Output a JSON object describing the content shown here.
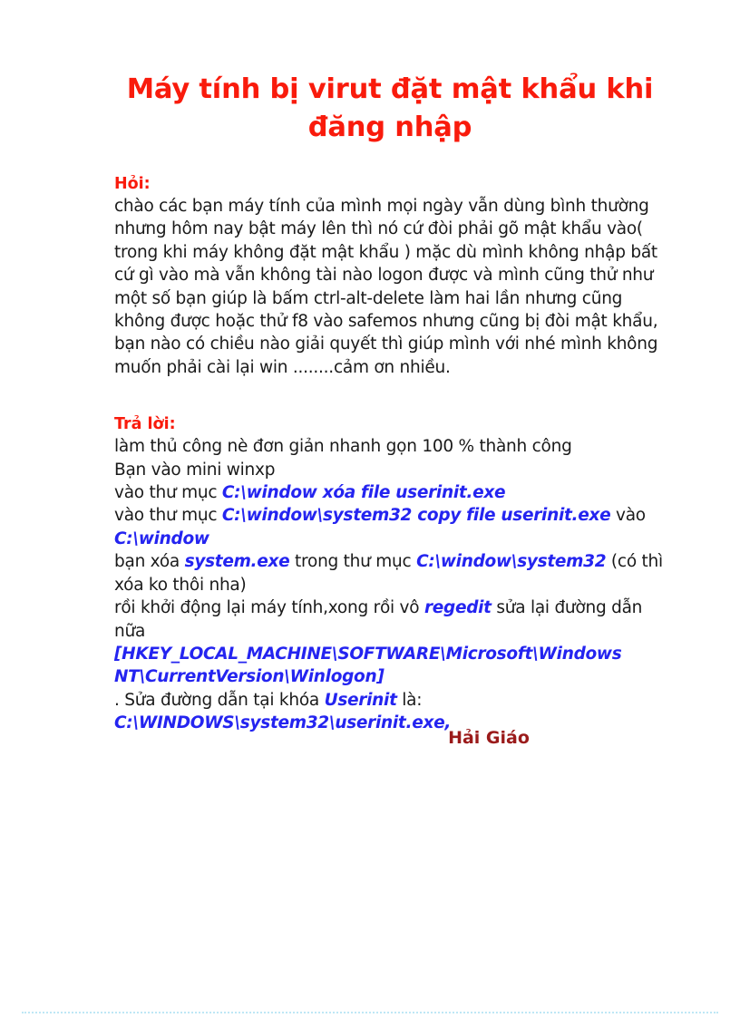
{
  "document": {
    "title": "Máy tính bị virut đặt mật khẩu khi đăng nhập",
    "title_color": "#F91B0C",
    "body_color": "#1a1a1a",
    "path_color": "#2424F0",
    "signature_color": "#9B1B1B",
    "rule_color": "#BEE7F5",
    "background": "#ffffff"
  },
  "question": {
    "label": "Hỏi:",
    "body": "chào các bạn máy tính của mình mọi ngày vẫn dùng bình thường nhưng hôm nay bật máy lên thì nó cứ đòi phải gõ mật khẩu vào( trong khi máy không đặt mật khẩu ) mặc dù mình không nhập bất cứ gì vào mà vẫn không tài nào logon được và mình cũng thử như một số bạn giúp là bấm ctrl-alt-delete làm hai lần nhưng cũng không được hoặc thử f8 vào safemos nhưng cũng bị đòi mật khẩu, bạn nào có chiều nào giải quyết thì giúp mình với nhé mình không muốn phải cài lại win ........cảm ơn nhiều."
  },
  "answer": {
    "label": "Trả lời:",
    "line1": "làm thủ công nè đơn giản nhanh gọn 100 % thành công",
    "line2": "Bạn vào mini winxp",
    "line3_pre": "vào thư mục ",
    "line3_path": "C:\\window xóa file userinit.exe",
    "line4_pre": "vào thư mục ",
    "line4_path": "C:\\window\\system32 copy file userinit.exe",
    "line4_mid": " vào",
    "line5_path": "C:\\window",
    "line6_pre": "bạn xóa ",
    "line6_path1": "system.exe",
    "line6_mid": " trong thư mục ",
    "line6_path2": "C:\\window\\system32",
    "line6_post": " (có thì xóa ko thôi nha)",
    "line7_pre": "rồi khởi động lại máy tính,xong rồi vô ",
    "line7_path": "regedit",
    "line7_post": " sửa lại đường dẫn nữa",
    "regkey": "[HKEY_LOCAL_MACHINE\\SOFTWARE\\Microsoft\\Windows NT\\CurrentVersion\\Winlogon]",
    "line9_pre": ". Sửa đường dẫn tại khóa ",
    "line9_path": "Userinit",
    "line9_post": " là:",
    "line10_path": "C:\\WINDOWS\\system32\\userinit.exe,"
  },
  "signature": {
    "name": "Hải Giáo"
  }
}
